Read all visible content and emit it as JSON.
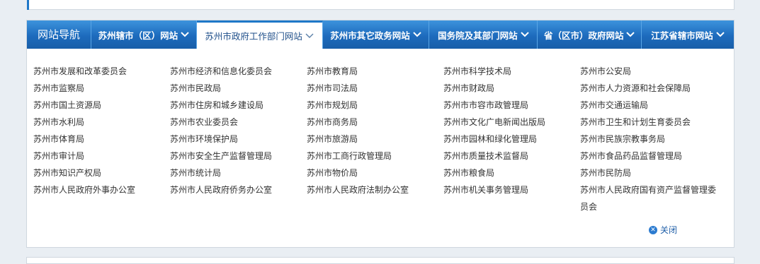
{
  "nav": {
    "title": "网站导航",
    "tabs": [
      {
        "label": "苏州辖市（区）网站"
      },
      {
        "label": "苏州市政府工作部门网站"
      },
      {
        "label": "苏州市其它政务网站"
      },
      {
        "label": "国务院及其部门网站"
      },
      {
        "label": "省（区市）政府网站"
      },
      {
        "label": "江苏省辖市网站"
      }
    ],
    "active_tab_index": 1
  },
  "links": [
    "苏州市发展和改革委员会",
    "苏州市经济和信息化委员会",
    "苏州市教育局",
    "苏州市科学技术局",
    "苏州市公安局",
    "苏州市监察局",
    "苏州市民政局",
    "苏州市司法局",
    "苏州市财政局",
    "苏州市人力资源和社会保障局",
    "苏州市国土资源局",
    "苏州市住房和城乡建设局",
    "苏州市规划局",
    "苏州市市容市政管理局",
    "苏州市交通运输局",
    "苏州市水利局",
    "苏州市农业委员会",
    "苏州市商务局",
    "苏州市文化广电新闻出版局",
    "苏州市卫生和计划生育委员会",
    "苏州市体育局",
    "苏州市环境保护局",
    "苏州市旅游局",
    "苏州市园林和绿化管理局",
    "苏州市民族宗教事务局",
    "苏州市审计局",
    "苏州市安全生产监督管理局",
    "苏州市工商行政管理局",
    "苏州市质量技术监督局",
    "苏州市食品药品监督管理局",
    "苏州市知识产权局",
    "苏州市统计局",
    "苏州市物价局",
    "苏州市粮食局",
    "苏州市民防局",
    "苏州市人民政府外事办公室",
    "苏州市人民政府侨务办公室",
    "苏州市人民政府法制办公室",
    "苏州市机关事务管理局",
    "苏州市人民政府国有资产监督管理委员会"
  ],
  "close_label": "关闭",
  "colors": {
    "accent": "#1f78c8",
    "nav_bg": "#1d6bbd",
    "text": "#333333"
  }
}
